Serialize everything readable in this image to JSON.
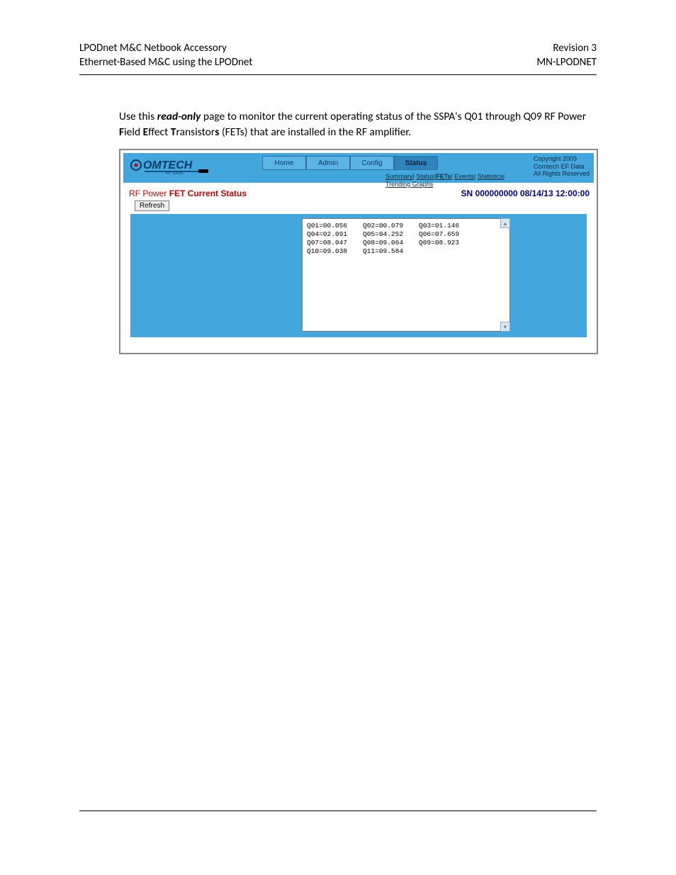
{
  "doc_header": {
    "left_line1": "LPODnet M&C Netbook Accessory",
    "left_line2": "Ethernet-Based M&C using the LPODnet",
    "right_line1": "Revision 3",
    "right_line2": "MN-LPODNET"
  },
  "paragraph": {
    "pre": "Use this ",
    "readonly": "read-only",
    "mid1": " page to monitor the current operating status of the SSPA's Q01 through Q09 RF Power ",
    "F": "F",
    "mid2": "ield ",
    "E": "E",
    "mid3": "ffect ",
    "T": "T",
    "mid4": "ransistor",
    "s": "s",
    "post": " (FETs) that are installed in the RF amplifier."
  },
  "app": {
    "logo_text_main": "OMTECH",
    "logo_text_sub": "EF DATA",
    "tabs": {
      "home": "Home",
      "admin": "Admin",
      "config": "Config",
      "status": "Status"
    },
    "copyright": {
      "l1": "Copyright 2009",
      "l2": "Comtech EF Data",
      "l3": "All Rights Reserved"
    },
    "subnav": {
      "summary": "Summary",
      "status": "Status",
      "fets": "FETs",
      "events": "Events",
      "statistics": "Statistics",
      "trending": "Trending Graphs"
    },
    "status_title_plain1": "RF Power ",
    "status_title_bold": "FET Current Status",
    "sn": "SN 000000000 08/14/13 12:00:00",
    "refresh": "Refresh",
    "fet_cols": {
      "c1": "Q01=00.056\nQ04=02.091\nQ07=08.047\nQ10=09.038",
      "c2": "Q02=00.079\nQ05=04.252\nQ08=09.064\nQ11=09.584",
      "c3": "Q03=01.146\nQ06=07.659\nQ09=08.923"
    },
    "scroll_up": "▴",
    "scroll_down": "▾"
  }
}
